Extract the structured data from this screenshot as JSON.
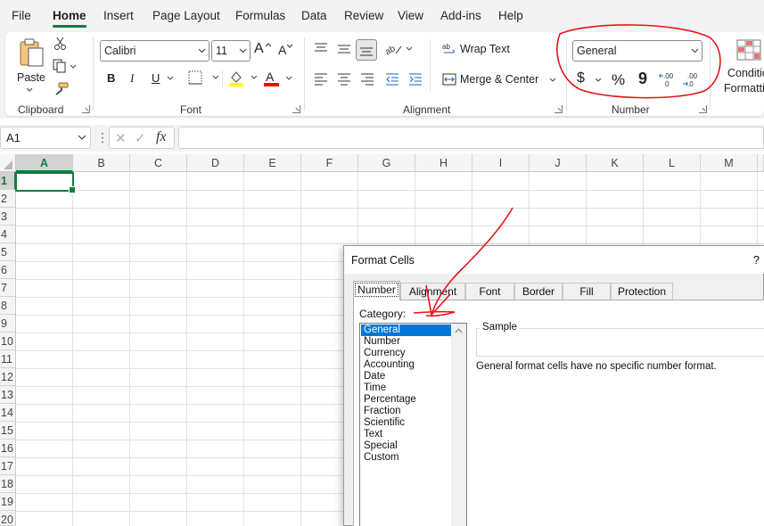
{
  "menu": {
    "tabs": [
      "File",
      "Home",
      "Insert",
      "Page Layout",
      "Formulas",
      "Data",
      "Review",
      "View",
      "Add-ins",
      "Help"
    ],
    "active": "Home"
  },
  "ribbon": {
    "clipboard": {
      "paste_label": "Paste",
      "group_label": "Clipboard"
    },
    "font": {
      "font_name": "Calibri",
      "font_size": "11",
      "group_label": "Font",
      "bold": "B",
      "italic": "I",
      "underline": "U",
      "grow": "A",
      "shrink": "A"
    },
    "alignment": {
      "wrap_text": "Wrap Text",
      "merge_center": "Merge & Center",
      "group_label": "Alignment"
    },
    "number": {
      "format": "General",
      "group_label": "Number",
      "currency": "$",
      "percent": "%",
      "comma": "9"
    },
    "styles": {
      "conditional_line1": "Conditio",
      "conditional_line2": "Formattin"
    },
    "colors": {
      "accent": "#107c41",
      "highlight": "#ffff00",
      "font_color": "#ff0000"
    }
  },
  "formula_bar": {
    "name_box": "A1",
    "fx": "fx",
    "cancel": "✕",
    "enter": "✓",
    "more": "⋮"
  },
  "grid": {
    "columns": [
      "A",
      "B",
      "C",
      "D",
      "E",
      "F",
      "G",
      "H",
      "I",
      "J",
      "K",
      "L",
      "M"
    ],
    "rows": [
      "1",
      "2",
      "3",
      "4",
      "5",
      "6",
      "7",
      "8",
      "9",
      "10",
      "11",
      "12",
      "13",
      "14",
      "15",
      "16",
      "17",
      "18",
      "19",
      "20"
    ],
    "active_cell": "A1"
  },
  "dialog": {
    "title": "Format Cells",
    "help": "?",
    "tabs": [
      "Number",
      "Alignment",
      "Font",
      "Border",
      "Fill",
      "Protection"
    ],
    "active_tab": "Number",
    "category_label": "Category:",
    "categories": [
      "General",
      "Number",
      "Currency",
      "Accounting",
      "Date",
      "Time",
      "Percentage",
      "Fraction",
      "Scientific",
      "Text",
      "Special",
      "Custom"
    ],
    "selected_category": "General",
    "sample_label": "Sample",
    "description": "General format cells have no specific number format."
  },
  "annotation_color": "#e8141a"
}
